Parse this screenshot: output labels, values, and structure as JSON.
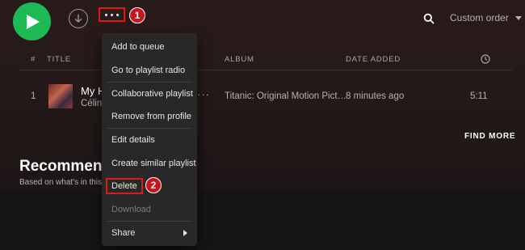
{
  "toolbar": {
    "play_icon": "play-icon",
    "download_icon": "download-icon",
    "more_icon": "more-horizontal-icon",
    "search_icon": "search-icon",
    "sort_label": "Custom order"
  },
  "annotations": {
    "step1": "1",
    "step2": "2"
  },
  "table": {
    "headers": {
      "index": "#",
      "title": "TITLE",
      "album": "ALBUM",
      "date_added": "DATE ADDED",
      "duration_icon": "clock-icon"
    },
    "rows": [
      {
        "index": "1",
        "title": "My H",
        "artist": "Céline",
        "album": "Titanic: Original Motion Pict…",
        "date_added": "8 minutes ago",
        "duration": "5:11"
      }
    ]
  },
  "find_more": "FIND MORE",
  "recommended": {
    "title": "Recommended",
    "subtitle": "Based on what's in this playlist"
  },
  "context_menu": {
    "items": [
      {
        "label": "Add to queue"
      },
      {
        "label": "Go to playlist radio"
      },
      {
        "label": "Collaborative playlist"
      },
      {
        "label": "Remove from profile"
      },
      {
        "label": "Edit details"
      },
      {
        "label": "Create similar playlist"
      },
      {
        "label": "Delete"
      },
      {
        "label": "Download"
      },
      {
        "label": "Share"
      }
    ]
  },
  "colors": {
    "accent_green": "#1db954",
    "highlight_red": "#d81b1b",
    "menu_bg": "#282828"
  }
}
